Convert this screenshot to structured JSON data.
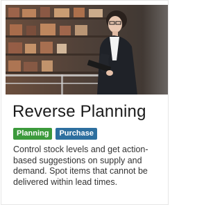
{
  "card": {
    "title": "Reverse Planning",
    "tags": [
      {
        "label": "Planning",
        "color": "#3c9a3c"
      },
      {
        "label": "Purchase",
        "color": "#2d6f9f"
      }
    ],
    "description": "Control stock levels and get action-based suggestions on supply and demand. Spot items that cannot be delivered within lead times."
  },
  "image": {
    "subject": "warehouse-worker-with-tablet-image"
  }
}
